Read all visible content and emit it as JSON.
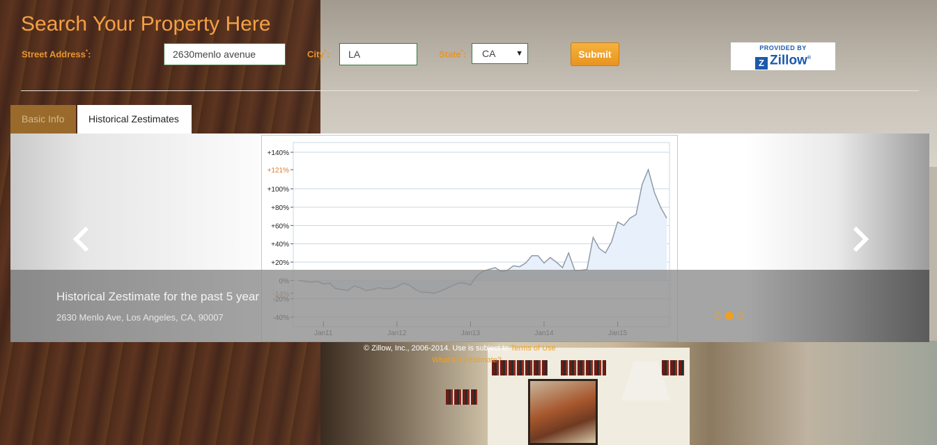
{
  "header": {
    "title": "Search Your Property Here",
    "street_label": "Street Address",
    "street_value": "2630menlo avenue",
    "city_label": "City",
    "city_value": "LA",
    "state_label": "State",
    "state_value": "CA",
    "required_mark": "*",
    "colon": ":",
    "submit_label": "Submit",
    "provider": {
      "provided_by": "PROVIDED BY",
      "brand": "Zillow"
    }
  },
  "tabs": [
    {
      "label": "Basic Info",
      "active": false
    },
    {
      "label": "Historical Zestimates",
      "active": true
    }
  ],
  "carousel": {
    "caption_title": "Historical Zestimate for the past 5 year",
    "caption_sub": "2630 Menlo Ave, Los Angeles, CA, 90007",
    "slides": 3,
    "active_slide": 1
  },
  "footer": {
    "copyright": "© Zillow, Inc., 2006-2014. Use is subject to",
    "terms_link": "Terms of Use",
    "whats_link": "What's a Zestimate?"
  },
  "chart_data": {
    "type": "line",
    "title": "",
    "xlabel": "",
    "ylabel": "",
    "ylim": [
      -40,
      140
    ],
    "y_ticks": [
      "+140%",
      "+121%",
      "+100%",
      "+80%",
      "+60%",
      "+40%",
      "+20%",
      "0%",
      "-14%",
      "-20%",
      "-40%"
    ],
    "highlight_ticks": [
      "+121%",
      "-14%"
    ],
    "x_ticks": [
      "Jan11",
      "Jan12",
      "Jan13",
      "Jan14",
      "Jan15"
    ],
    "series": [
      {
        "values": [
          0,
          -1,
          -2,
          -1,
          -4,
          -3,
          -9,
          -10,
          -11,
          -6,
          -8,
          -11,
          -10,
          -8,
          -9,
          -9,
          -7,
          -3,
          -5,
          -10,
          -13,
          -13,
          -14,
          -12,
          -9,
          -6,
          -3,
          -3,
          -5,
          5,
          10,
          12,
          14,
          10,
          11,
          16,
          15,
          19,
          27,
          27,
          19,
          25,
          20,
          14,
          30,
          11,
          11,
          12,
          47,
          35,
          30,
          42,
          64,
          60,
          68,
          72,
          105,
          121,
          96,
          80,
          68
        ],
        "x_start": "Sep 2010",
        "x_end": "Mar 2015"
      }
    ],
    "grid": true
  },
  "colors": {
    "accent": "#f5a045",
    "line": "#8e9aa6",
    "fill": "#e8f0fb",
    "grid": "#c8d7e6",
    "highlight_tick": "#e0782a",
    "zillow_blue": "#1b5aab"
  }
}
